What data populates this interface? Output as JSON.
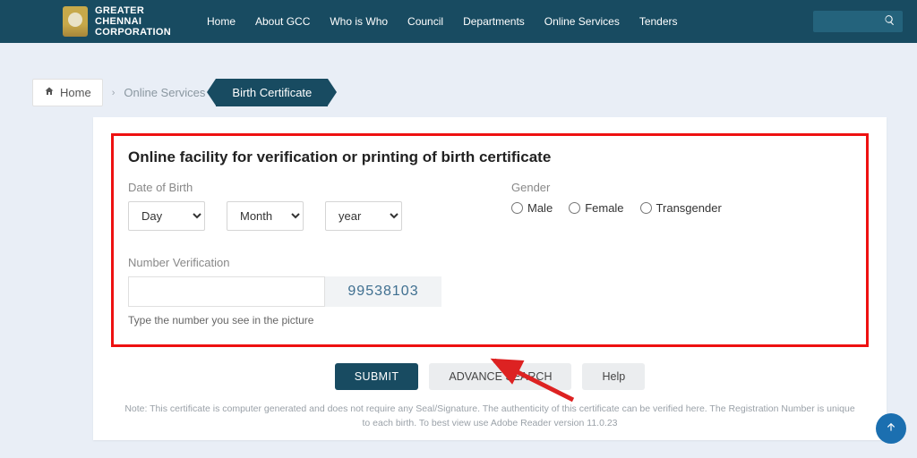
{
  "brand": {
    "line1": "GREATER",
    "line2": "CHENNAI",
    "line3": "CORPORATION"
  },
  "nav": {
    "home": "Home",
    "about": "About GCC",
    "who": "Who is Who",
    "council": "Council",
    "departments": "Departments",
    "services": "Online Services",
    "tenders": "Tenders"
  },
  "breadcrumb": {
    "home": "Home",
    "services": "Online Services",
    "current": "Birth Certificate"
  },
  "form": {
    "title": "Online facility for verification or printing of birth certificate",
    "dob_label": "Date of Birth",
    "day": "Day",
    "month": "Month",
    "year": "year",
    "gender_label": "Gender",
    "gender": {
      "male": "Male",
      "female": "Female",
      "trans": "Transgender"
    },
    "nv_label": "Number Verification",
    "captcha": "99538103",
    "hint": "Type the number you see in the picture"
  },
  "buttons": {
    "submit": "SUBMIT",
    "advance": "ADVANCE SEARCH",
    "help": "Help"
  },
  "note": "Note: This certificate is computer generated and does not require any Seal/Signature. The authenticity of this certificate can be verified here. The Registration Number is unique to each birth. To best view use Adobe Reader version 11.0.23"
}
